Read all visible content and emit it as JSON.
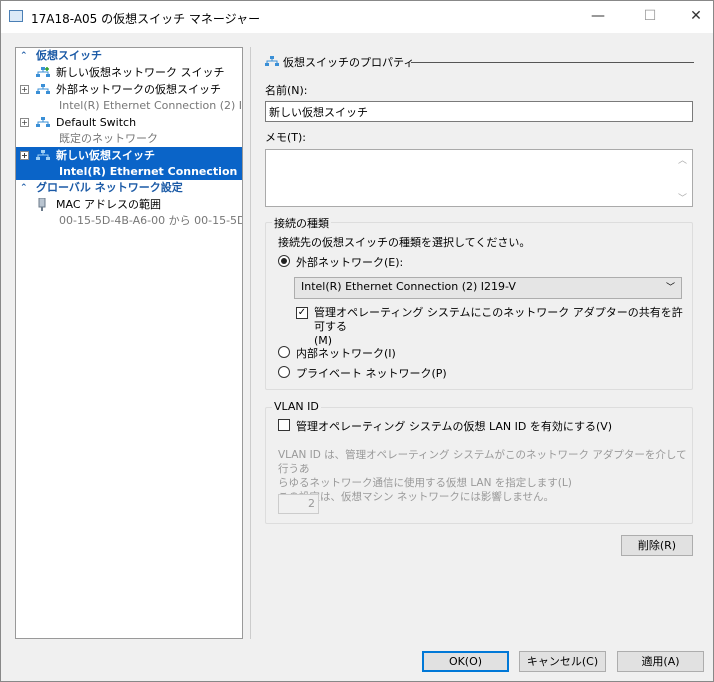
{
  "window": {
    "title": "17A18-A05 の仮想スイッチ マネージャー",
    "minimize": "—",
    "maximize": "☐",
    "close": "✕"
  },
  "sidebar": {
    "section1": "仮想スイッチ",
    "items": [
      {
        "label": "新しい仮想ネットワーク スイッチ",
        "sub": ""
      },
      {
        "label": "外部ネットワークの仮想スイッチ",
        "sub": "Intel(R) Ethernet Connection (2) I..."
      },
      {
        "label": "Default Switch",
        "sub": "既定のネットワーク"
      },
      {
        "label": "新しい仮想スイッチ",
        "sub": "Intel(R) Ethernet Connection ...",
        "selected": true
      }
    ],
    "section2": "グローバル ネットワーク設定",
    "mac": {
      "label": "MAC アドレスの範囲",
      "sub": "00-15-5D-4B-A6-00 から 00-15-5D-..."
    }
  },
  "props": {
    "header": "仮想スイッチのプロパティ",
    "name_label": "名前(N):",
    "name_value": "新しい仮想スイッチ",
    "memo_label": "メモ(T):",
    "memo_value": "",
    "conn_group": "接続の種類",
    "conn_desc": "接続先の仮想スイッチの種類を選択してください。",
    "external": "外部ネットワーク(E):",
    "adapter": "Intel(R) Ethernet Connection (2) I219-V",
    "share_label": "管理オペレーティング システムにこのネットワーク アダプターの共有を許可する",
    "share_key": "(M)",
    "share_checked": true,
    "internal": "内部ネットワーク(I)",
    "private": "プライベート ネットワーク(P)",
    "selected_type": "external",
    "vlan_group": "VLAN ID",
    "vlan_enable": "管理オペレーティング システムの仮想 LAN ID を有効にする(V)",
    "vlan_checked": false,
    "vlan_desc1": "VLAN ID は、管理オペレーティング システムがこのネットワーク アダプターを介して行うあ",
    "vlan_desc2": "らゆるネットワーク通信に使用する仮想 LAN を指定します(L)",
    "vlan_desc3": "この設定は、仮想マシン ネットワークには影響しません。",
    "vlan_value": "2",
    "delete": "削除(R)"
  },
  "footer": {
    "ok": "OK(O)",
    "cancel": "キャンセル(C)",
    "apply": "適用(A)"
  }
}
